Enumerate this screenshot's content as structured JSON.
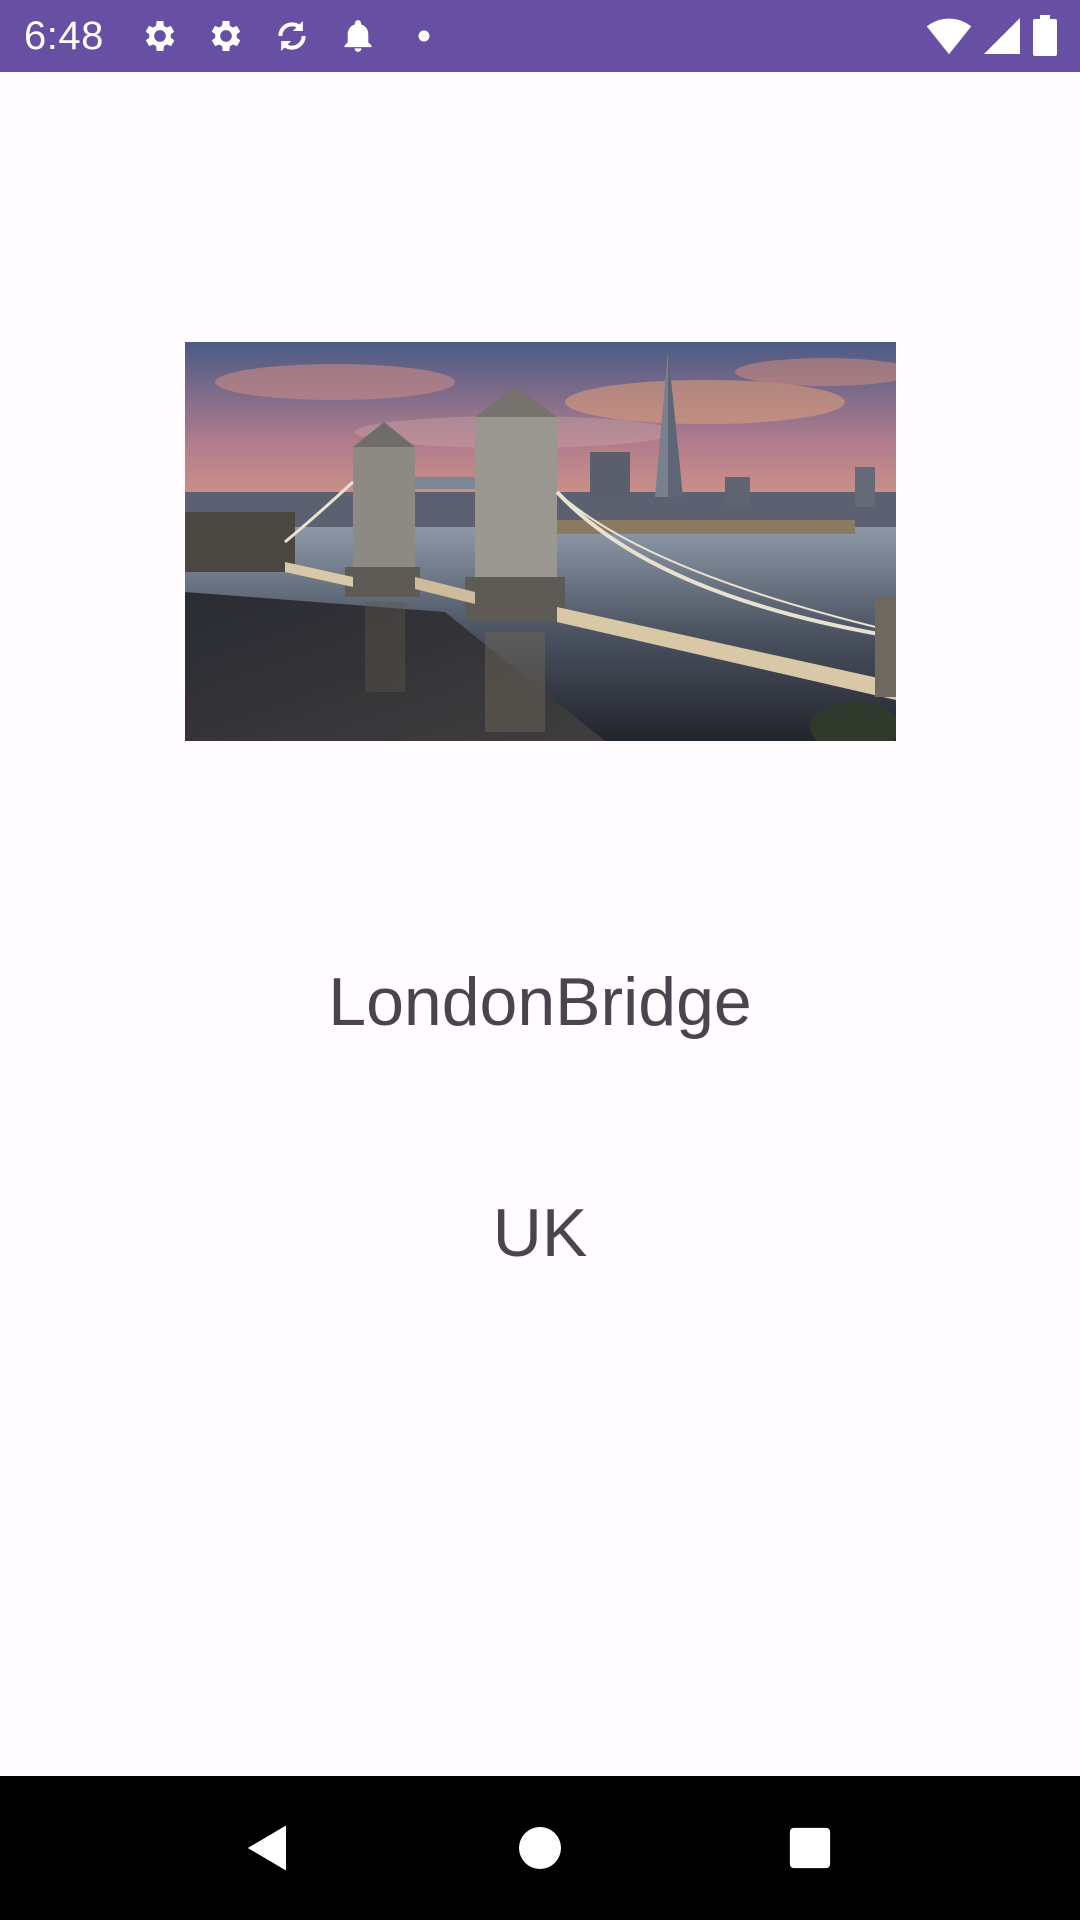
{
  "status_bar": {
    "time": "6:48",
    "background_color": "#6750a4",
    "left_icons": [
      "settings-icon",
      "settings-icon",
      "sync-icon",
      "notification-bell-icon",
      "dot-icon"
    ],
    "right_icons": [
      "wifi-icon",
      "cell-signal-icon",
      "battery-icon"
    ]
  },
  "landmark": {
    "image_icon": "tower-bridge-photo",
    "name": "LondonBridge",
    "country": "UK",
    "text_color": "#49454f"
  },
  "nav_bar": {
    "buttons": [
      "back-icon",
      "home-icon",
      "recents-icon"
    ]
  }
}
